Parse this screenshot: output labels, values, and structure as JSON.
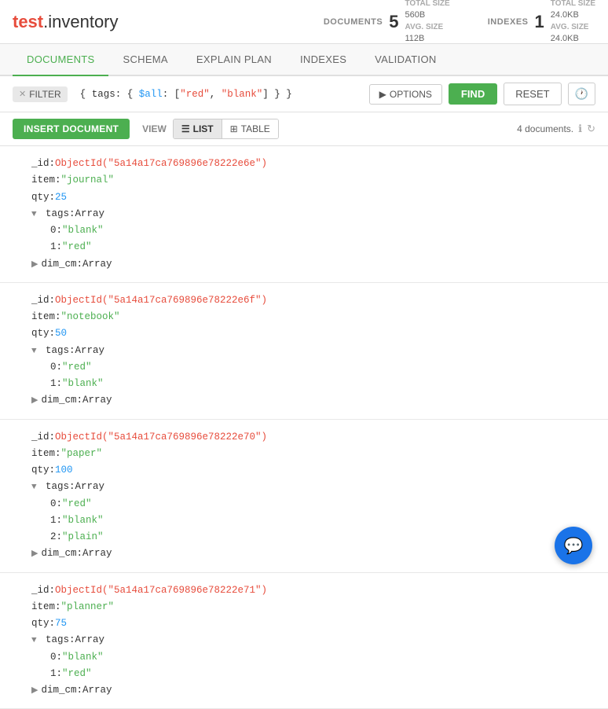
{
  "header": {
    "title_highlight": "test",
    "title_rest": ".inventory",
    "documents_label": "DOCUMENTS",
    "documents_count": "5",
    "total_size_label": "TOTAL SIZE",
    "total_size_docs": "560B",
    "avg_size_label": "AVG. SIZE",
    "avg_size_docs": "112B",
    "indexes_label": "INDEXES",
    "indexes_count": "1",
    "total_size_idx": "24.0KB",
    "avg_size_idx": "24.0KB"
  },
  "tabs": [
    {
      "id": "documents",
      "label": "DOCUMENTS",
      "active": true
    },
    {
      "id": "schema",
      "label": "SCHEMA",
      "active": false
    },
    {
      "id": "explain",
      "label": "EXPLAIN PLAN",
      "active": false
    },
    {
      "id": "indexes",
      "label": "INDEXES",
      "active": false
    },
    {
      "id": "validation",
      "label": "VALIDATION",
      "active": false
    }
  ],
  "toolbar": {
    "filter_label": "FILTER",
    "query_text": "{ tags: { $all: [\"red\", \"blank\"] } }",
    "options_label": "OPTIONS",
    "find_label": "FIND",
    "reset_label": "RESET"
  },
  "action_bar": {
    "insert_label": "INSERT DOCUMENT",
    "view_label": "VIEW",
    "list_label": "LIST",
    "table_label": "TABLE",
    "doc_count": "4 documents."
  },
  "documents": [
    {
      "id": "ObjectId(\"5a14a17ca769896e78222e6e\")",
      "item": "journal",
      "qty": "25",
      "tags_type": "Array",
      "tags": [
        {
          "index": "0",
          "value": "blank"
        },
        {
          "index": "1",
          "value": "red"
        }
      ],
      "dim_cm_type": "Array"
    },
    {
      "id": "ObjectId(\"5a14a17ca769896e78222e6f\")",
      "item": "notebook",
      "qty": "50",
      "tags_type": "Array",
      "tags": [
        {
          "index": "0",
          "value": "red"
        },
        {
          "index": "1",
          "value": "blank"
        }
      ],
      "dim_cm_type": "Array"
    },
    {
      "id": "ObjectId(\"5a14a17ca769896e78222e70\")",
      "item": "paper",
      "qty": "100",
      "tags_type": "Array",
      "tags": [
        {
          "index": "0",
          "value": "red"
        },
        {
          "index": "1",
          "value": "blank"
        },
        {
          "index": "2",
          "value": "plain"
        }
      ],
      "dim_cm_type": "Array"
    },
    {
      "id": "ObjectId(\"5a14a17ca769896e78222e71\")",
      "item": "planner",
      "qty": "75",
      "tags_type": "Array",
      "tags": [
        {
          "index": "0",
          "value": "blank"
        },
        {
          "index": "1",
          "value": "red"
        }
      ],
      "dim_cm_type": "Array"
    }
  ],
  "chat": {
    "icon": "💬"
  }
}
